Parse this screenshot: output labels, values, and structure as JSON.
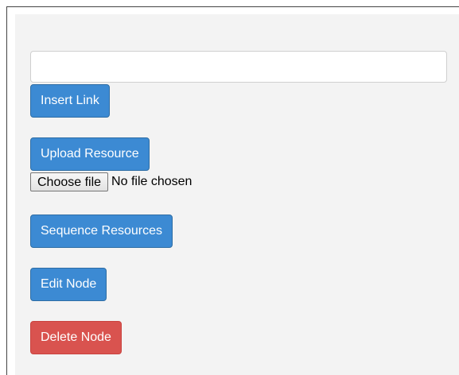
{
  "link_input": {
    "value": "",
    "placeholder": ""
  },
  "buttons": {
    "insert_link": "Insert Link",
    "upload_resource": "Upload Resource",
    "sequence_resources": "Sequence Resources",
    "edit_node": "Edit Node",
    "delete_node": "Delete Node"
  },
  "file_input": {
    "button_label": "Choose file",
    "status": "No file chosen"
  },
  "colors": {
    "primary": "#3c8ad3",
    "danger": "#d9534f",
    "panel_background": "#f3f3f3"
  }
}
